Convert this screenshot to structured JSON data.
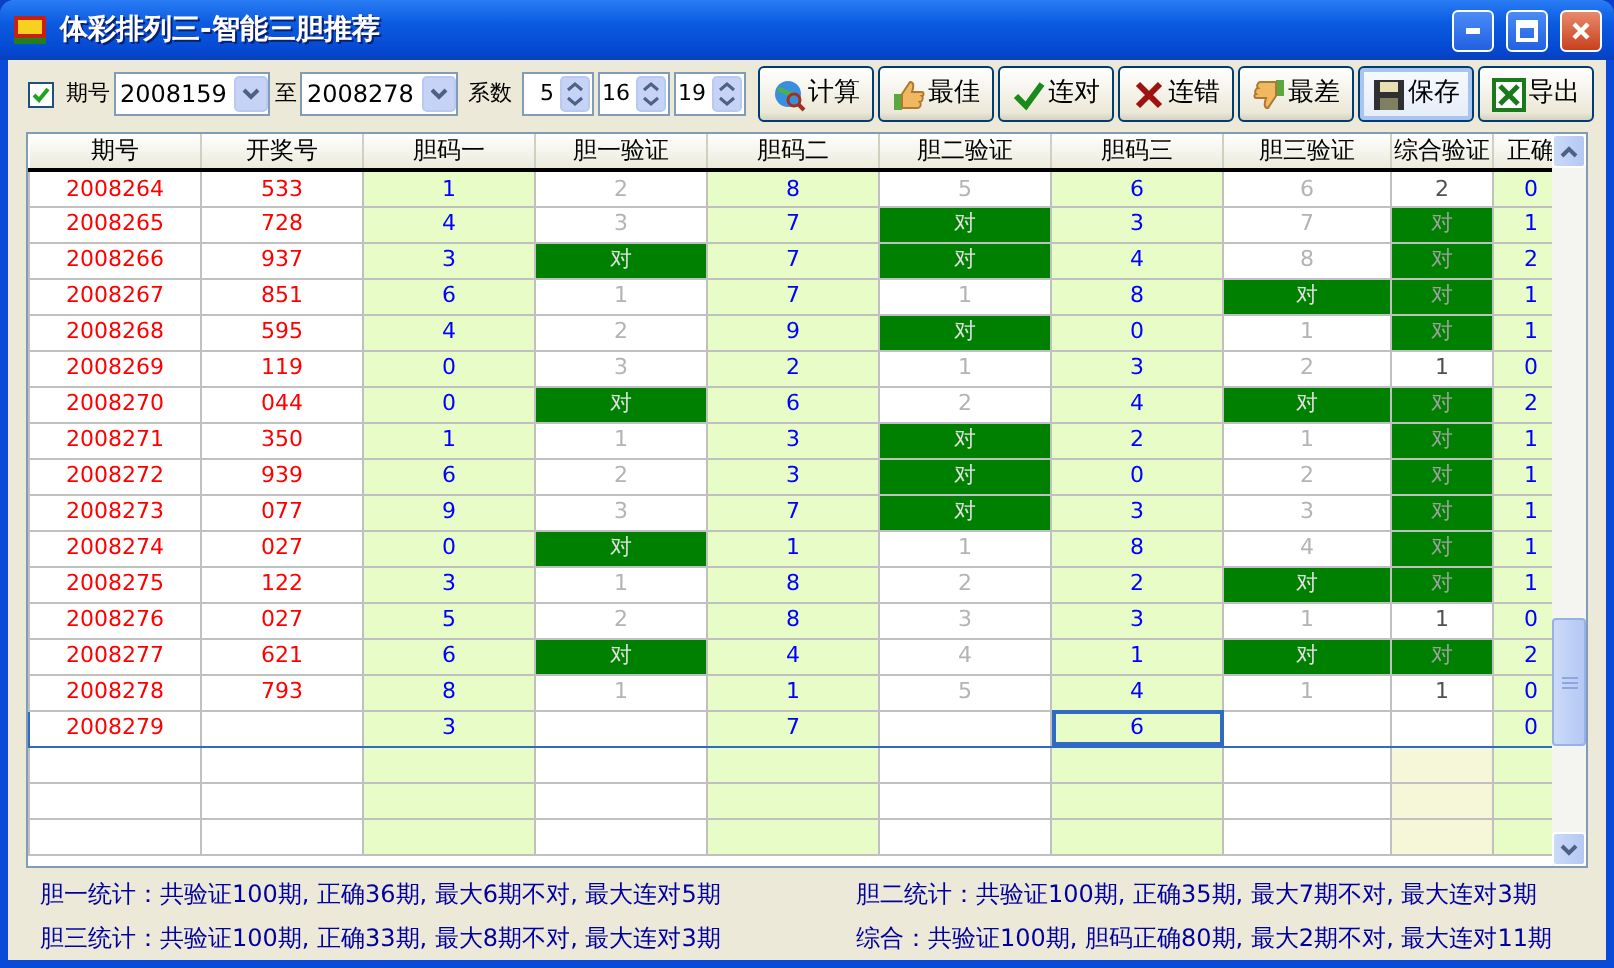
{
  "window": {
    "title": "体彩排列三-智能三胆推荐"
  },
  "toolbar": {
    "period_filter": {
      "label": "期号",
      "checked": true
    },
    "from": "2008159",
    "to_label": "至",
    "to": "2008278",
    "coef_label": "系数",
    "coefficients": [
      "5",
      "16",
      "19"
    ],
    "buttons": [
      {
        "label": "计算",
        "hover": false
      },
      {
        "label": "最佳",
        "hover": false
      },
      {
        "label": "连对",
        "hover": false
      },
      {
        "label": "连错",
        "hover": false
      },
      {
        "label": "最差",
        "hover": false
      },
      {
        "label": "保存",
        "hover": true
      },
      {
        "label": "导出",
        "hover": false
      }
    ]
  },
  "table": {
    "columns": [
      "期号",
      "开奖号",
      "胆码一",
      "胆一验证",
      "胆码二",
      "胆二验证",
      "胆码三",
      "胆三验证",
      "综合验证",
      "正确"
    ],
    "rows": [
      {
        "selected": false,
        "dan3_focused": false,
        "period": "2008264",
        "draw": "533",
        "dan1": "1",
        "check1": {
          "text": "2",
          "hit": false
        },
        "dan2": "8",
        "check2": {
          "text": "5",
          "hit": false
        },
        "dan3": "6",
        "check3": {
          "text": "6",
          "hit": false
        },
        "combo": {
          "text": "2",
          "hit": false
        },
        "correct": "0"
      },
      {
        "selected": false,
        "dan3_focused": false,
        "period": "2008265",
        "draw": "728",
        "dan1": "4",
        "check1": {
          "text": "3",
          "hit": false
        },
        "dan2": "7",
        "check2": {
          "text": "对",
          "hit": true
        },
        "dan3": "3",
        "check3": {
          "text": "7",
          "hit": false
        },
        "combo": {
          "text": "对",
          "hit": true
        },
        "correct": "1"
      },
      {
        "selected": false,
        "dan3_focused": false,
        "period": "2008266",
        "draw": "937",
        "dan1": "3",
        "check1": {
          "text": "对",
          "hit": true
        },
        "dan2": "7",
        "check2": {
          "text": "对",
          "hit": true
        },
        "dan3": "4",
        "check3": {
          "text": "8",
          "hit": false
        },
        "combo": {
          "text": "对",
          "hit": true
        },
        "correct": "2"
      },
      {
        "selected": false,
        "dan3_focused": false,
        "period": "2008267",
        "draw": "851",
        "dan1": "6",
        "check1": {
          "text": "1",
          "hit": false
        },
        "dan2": "7",
        "check2": {
          "text": "1",
          "hit": false
        },
        "dan3": "8",
        "check3": {
          "text": "对",
          "hit": true
        },
        "combo": {
          "text": "对",
          "hit": true
        },
        "correct": "1"
      },
      {
        "selected": false,
        "dan3_focused": false,
        "period": "2008268",
        "draw": "595",
        "dan1": "4",
        "check1": {
          "text": "2",
          "hit": false
        },
        "dan2": "9",
        "check2": {
          "text": "对",
          "hit": true
        },
        "dan3": "0",
        "check3": {
          "text": "1",
          "hit": false
        },
        "combo": {
          "text": "对",
          "hit": true
        },
        "correct": "1"
      },
      {
        "selected": false,
        "dan3_focused": false,
        "period": "2008269",
        "draw": "119",
        "dan1": "0",
        "check1": {
          "text": "3",
          "hit": false
        },
        "dan2": "2",
        "check2": {
          "text": "1",
          "hit": false
        },
        "dan3": "3",
        "check3": {
          "text": "2",
          "hit": false
        },
        "combo": {
          "text": "1",
          "hit": false
        },
        "correct": "0"
      },
      {
        "selected": false,
        "dan3_focused": false,
        "period": "2008270",
        "draw": "044",
        "dan1": "0",
        "check1": {
          "text": "对",
          "hit": true
        },
        "dan2": "6",
        "check2": {
          "text": "2",
          "hit": false
        },
        "dan3": "4",
        "check3": {
          "text": "对",
          "hit": true
        },
        "combo": {
          "text": "对",
          "hit": true
        },
        "correct": "2"
      },
      {
        "selected": false,
        "dan3_focused": false,
        "period": "2008271",
        "draw": "350",
        "dan1": "1",
        "check1": {
          "text": "1",
          "hit": false
        },
        "dan2": "3",
        "check2": {
          "text": "对",
          "hit": true
        },
        "dan3": "2",
        "check3": {
          "text": "1",
          "hit": false
        },
        "combo": {
          "text": "对",
          "hit": true
        },
        "correct": "1"
      },
      {
        "selected": false,
        "dan3_focused": false,
        "period": "2008272",
        "draw": "939",
        "dan1": "6",
        "check1": {
          "text": "2",
          "hit": false
        },
        "dan2": "3",
        "check2": {
          "text": "对",
          "hit": true
        },
        "dan3": "0",
        "check3": {
          "text": "2",
          "hit": false
        },
        "combo": {
          "text": "对",
          "hit": true
        },
        "correct": "1"
      },
      {
        "selected": false,
        "dan3_focused": false,
        "period": "2008273",
        "draw": "077",
        "dan1": "9",
        "check1": {
          "text": "3",
          "hit": false
        },
        "dan2": "7",
        "check2": {
          "text": "对",
          "hit": true
        },
        "dan3": "3",
        "check3": {
          "text": "3",
          "hit": false
        },
        "combo": {
          "text": "对",
          "hit": true
        },
        "correct": "1"
      },
      {
        "selected": false,
        "dan3_focused": false,
        "period": "2008274",
        "draw": "027",
        "dan1": "0",
        "check1": {
          "text": "对",
          "hit": true
        },
        "dan2": "1",
        "check2": {
          "text": "1",
          "hit": false
        },
        "dan3": "8",
        "check3": {
          "text": "4",
          "hit": false
        },
        "combo": {
          "text": "对",
          "hit": true
        },
        "correct": "1"
      },
      {
        "selected": false,
        "dan3_focused": false,
        "period": "2008275",
        "draw": "122",
        "dan1": "3",
        "check1": {
          "text": "1",
          "hit": false
        },
        "dan2": "8",
        "check2": {
          "text": "2",
          "hit": false
        },
        "dan3": "2",
        "check3": {
          "text": "对",
          "hit": true
        },
        "combo": {
          "text": "对",
          "hit": true
        },
        "correct": "1"
      },
      {
        "selected": false,
        "dan3_focused": false,
        "period": "2008276",
        "draw": "027",
        "dan1": "5",
        "check1": {
          "text": "2",
          "hit": false
        },
        "dan2": "8",
        "check2": {
          "text": "3",
          "hit": false
        },
        "dan3": "3",
        "check3": {
          "text": "1",
          "hit": false
        },
        "combo": {
          "text": "1",
          "hit": false
        },
        "correct": "0"
      },
      {
        "selected": false,
        "dan3_focused": false,
        "period": "2008277",
        "draw": "621",
        "dan1": "6",
        "check1": {
          "text": "对",
          "hit": true
        },
        "dan2": "4",
        "check2": {
          "text": "4",
          "hit": false
        },
        "dan3": "1",
        "check3": {
          "text": "对",
          "hit": true
        },
        "combo": {
          "text": "对",
          "hit": true
        },
        "correct": "2"
      },
      {
        "selected": false,
        "dan3_focused": false,
        "period": "2008278",
        "draw": "793",
        "dan1": "8",
        "check1": {
          "text": "1",
          "hit": false
        },
        "dan2": "1",
        "check2": {
          "text": "5",
          "hit": false
        },
        "dan3": "4",
        "check3": {
          "text": "1",
          "hit": false
        },
        "combo": {
          "text": "1",
          "hit": false
        },
        "correct": "0"
      },
      {
        "selected": true,
        "dan3_focused": true,
        "period": "2008279",
        "dan1": "3",
        "dan2": "7",
        "dan3": "6",
        "correct": "0"
      }
    ]
  },
  "statistics": [
    "胆一统计：共验证100期, 正确36期, 最大6期不对, 最大连对5期",
    "胆二统计：共验证100期, 正确35期, 最大7期不对, 最大连对3期",
    "胆三统计：共验证100期, 正确33期, 最大8期不对, 最大连对3期",
    "综合：共验证100期, 胆码正确80期, 最大2期不对, 最大连对11期"
  ]
}
